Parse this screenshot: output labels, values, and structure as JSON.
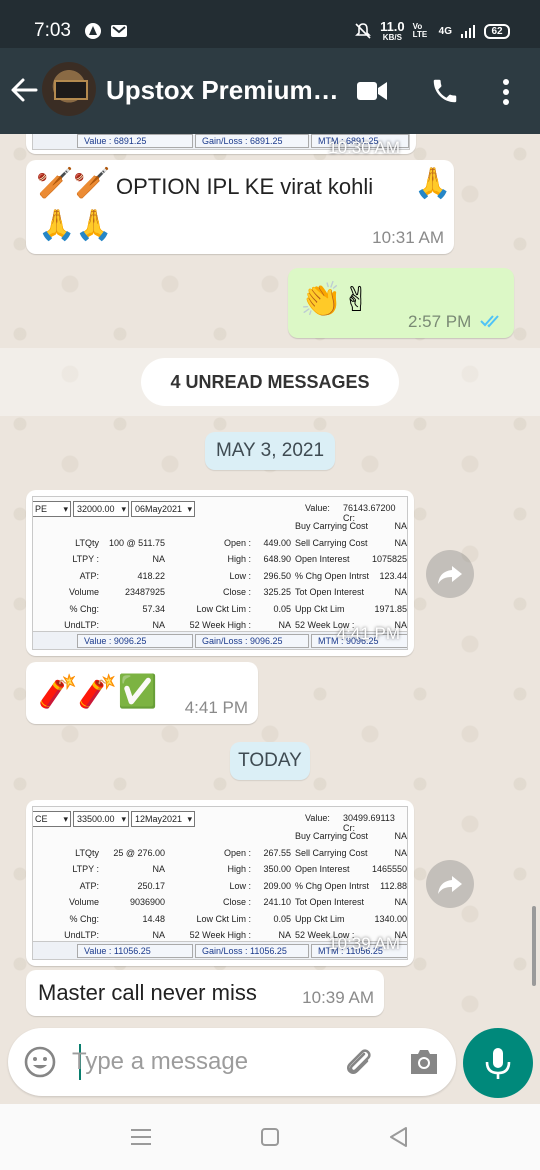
{
  "status_bar": {
    "time": "7:03",
    "net_speed_value": "11.0",
    "net_speed_unit": "KB/S",
    "volte": "Vo LTE",
    "network": "4G",
    "battery": "62"
  },
  "header": {
    "title": "Upstox Premium…"
  },
  "messages": {
    "top_partial": {
      "value_label": "Value : 6891.25",
      "gain_loss": "Gain/Loss : 6891.25",
      "mtm": "MTM : 6891.25",
      "time": "10:30 AM"
    },
    "ipl": {
      "text": "OPTION IPL KE virat kohli",
      "time": "10:31 AM"
    },
    "sent_emojis": {
      "time": "2:57 PM"
    },
    "unread_label": "4 UNREAD MESSAGES",
    "date1": "MAY 3, 2021",
    "screenshot1": {
      "type_sel": "PE",
      "strike_sel": "32000.00",
      "expiry_sel": "06May2021",
      "value": "Value:",
      "value_amt": "76143.67200 Cr:",
      "rows": [
        {
          "c1": "",
          "c2": "",
          "c3": "",
          "c4": "",
          "c5": "Buy Carrying Cost",
          "c6": "NA"
        },
        {
          "c1": "LTQty",
          "c2": "100 @ 511.75",
          "c3": "Open :",
          "c4": "449.00",
          "c5": "Sell Carrying Cost",
          "c6": "NA"
        },
        {
          "c1": "LTPY :",
          "c2": "NA",
          "c3": "High :",
          "c4": "648.90",
          "c5": "Open Interest",
          "c6": "1075825"
        },
        {
          "c1": "ATP:",
          "c2": "418.22",
          "c3": "Low :",
          "c4": "296.50",
          "c5": "% Chg Open Intrst",
          "c6": "123.44"
        },
        {
          "c1": "Volume",
          "c2": "23487925",
          "c3": "Close :",
          "c4": "325.25",
          "c5": "Tot Open Interest",
          "c6": "NA"
        },
        {
          "c1": "% Chg:",
          "c2": "57.34",
          "c3": "Low Ckt Lim :",
          "c4": "0.05",
          "c5": "Upp Ckt Lim",
          "c6": "1971.85"
        },
        {
          "c1": "UndLTP:",
          "c2": "NA",
          "c3": "52 Week High :",
          "c4": "NA",
          "c5": "52 Week Low :",
          "c6": "NA"
        }
      ],
      "footer_value": "Value : 9096.25",
      "footer_gain": "Gain/Loss : 9096.25",
      "footer_mtm": "MTM : 9096.25",
      "time": "4:41 PM"
    },
    "firecracker": {
      "time": "4:41 PM"
    },
    "date2": "TODAY",
    "screenshot2": {
      "type_sel": "CE",
      "strike_sel": "33500.00",
      "expiry_sel": "12May2021",
      "value": "Value:",
      "value_amt": "30499.69113 Cr:",
      "rows": [
        {
          "c1": "",
          "c2": "",
          "c3": "",
          "c4": "",
          "c5": "Buy Carrying Cost",
          "c6": "NA"
        },
        {
          "c1": "LTQty",
          "c2": "25 @ 276.00",
          "c3": "Open :",
          "c4": "267.55",
          "c5": "Sell Carrying Cost",
          "c6": "NA"
        },
        {
          "c1": "LTPY :",
          "c2": "NA",
          "c3": "High :",
          "c4": "350.00",
          "c5": "Open Interest",
          "c6": "1465550"
        },
        {
          "c1": "ATP:",
          "c2": "250.17",
          "c3": "Low :",
          "c4": "209.00",
          "c5": "% Chg Open Intrst",
          "c6": "112.88"
        },
        {
          "c1": "Volume",
          "c2": "9036900",
          "c3": "Close :",
          "c4": "241.10",
          "c5": "Tot Open Interest",
          "c6": "NA"
        },
        {
          "c1": "% Chg:",
          "c2": "14.48",
          "c3": "Low Ckt Lim :",
          "c4": "0.05",
          "c5": "Upp Ckt Lim",
          "c6": "1340.00"
        },
        {
          "c1": "UndLTP:",
          "c2": "NA",
          "c3": "52 Week High :",
          "c4": "NA",
          "c5": "52 Week Low :",
          "c6": "NA"
        }
      ],
      "footer_value": "Value : 11056.25",
      "footer_gain": "Gain/Loss : 11056.25",
      "footer_mtm": "MTM : 11056.25",
      "time": "10:39 AM"
    },
    "last": {
      "text": "Master call never miss",
      "time": "10:39 AM"
    }
  },
  "composer": {
    "placeholder": "Type a message"
  },
  "colors": {
    "appbar": "#2d3b42",
    "accent": "#00897b",
    "outgoing_bubble": "#dcf8c6",
    "read_ticks": "#4fc3f7"
  }
}
